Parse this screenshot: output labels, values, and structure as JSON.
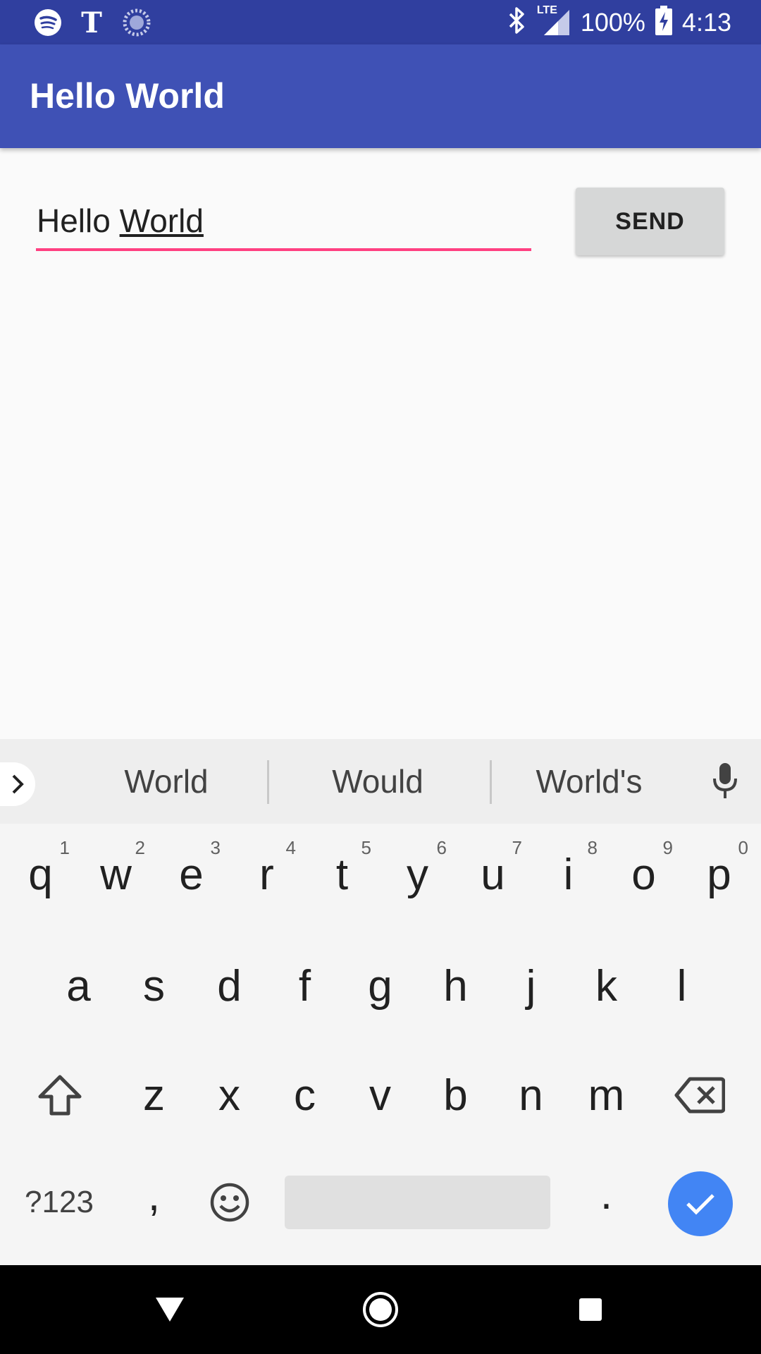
{
  "status_bar": {
    "notification_icons": [
      "spotify-icon",
      "nytimes-icon",
      "loading-indicator-icon"
    ],
    "bluetooth_icon": "bluetooth-icon",
    "network_type": "LTE",
    "battery_percent": "100%",
    "time": "4:13"
  },
  "app_bar": {
    "title": "Hello World"
  },
  "message_input": {
    "value_prefix": "Hello ",
    "composing_word": "World"
  },
  "send_button": {
    "label": "SEND"
  },
  "keyboard": {
    "suggestions": [
      "World",
      "Would",
      "World's"
    ],
    "row1": [
      {
        "key": "q",
        "hint": "1"
      },
      {
        "key": "w",
        "hint": "2"
      },
      {
        "key": "e",
        "hint": "3"
      },
      {
        "key": "r",
        "hint": "4"
      },
      {
        "key": "t",
        "hint": "5"
      },
      {
        "key": "y",
        "hint": "6"
      },
      {
        "key": "u",
        "hint": "7"
      },
      {
        "key": "i",
        "hint": "8"
      },
      {
        "key": "o",
        "hint": "9"
      },
      {
        "key": "p",
        "hint": "0"
      }
    ],
    "row2": [
      "a",
      "s",
      "d",
      "f",
      "g",
      "h",
      "j",
      "k",
      "l"
    ],
    "row3": [
      "z",
      "x",
      "c",
      "v",
      "b",
      "n",
      "m"
    ],
    "symbols_key": "?123",
    "comma_key": ",",
    "period_key": ".",
    "accent_color": "#4285f4"
  },
  "colors": {
    "status_bar": "#303f9f",
    "app_bar": "#3f51b5",
    "input_underline": "#ff4081",
    "send_button": "#d6d7d7"
  }
}
